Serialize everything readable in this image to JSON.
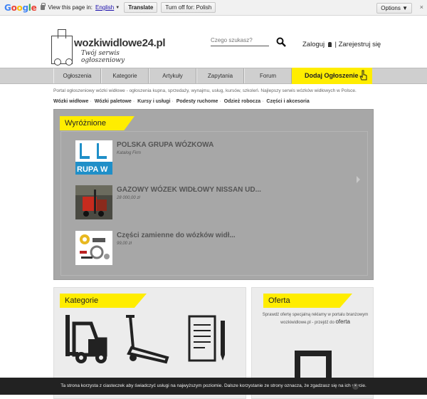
{
  "translate_bar": {
    "brand_letters": [
      "G",
      "o",
      "o",
      "g",
      "l",
      "e"
    ],
    "view_text": "View this page in:",
    "language": "English",
    "caret": "▼",
    "translate_label": "Translate",
    "turn_off_label": "Turn off for: Polish",
    "options_label": "Options ▼",
    "close_glyph": "×"
  },
  "header": {
    "logo_title": "wozkiwidlowe24.pl",
    "logo_tagline": "Twój serwis ogłoszeniowy",
    "search_placeholder": "Czego szukasz?",
    "login_label": "Zaloguj",
    "separator": "|",
    "register_label": "Zarejestruj się"
  },
  "nav": {
    "items": [
      "Ogłoszenia",
      "Kategorie",
      "Artykuły",
      "Zapytania",
      "Forum"
    ],
    "cta_label": "Dodaj Ogłoszenie"
  },
  "intro": "Portal ogłoszeniowy wózki widłowe - ogłoszenia kupna, sprzedaży, wynajmu, usług, kursów, szkoleń. Najlepszy serwis wózków widłowych w Polsce.",
  "categories_line": [
    "Wózki widłowe",
    "Wózki paletowe",
    "Kursy i usługi",
    "Podesty ruchome",
    "Odzież robocza",
    "Części i akcesoria"
  ],
  "featured": {
    "heading": "Wyróżnione",
    "items": [
      {
        "title": "POLSKA GRUPA WÓZKOWA",
        "sub": "Katalog Firm",
        "thumb_text": "RUPA W"
      },
      {
        "title": "GAZOWY WÓZEK WIDŁOWY NISSAN UD...",
        "sub": "28 000,00 zł"
      },
      {
        "title": "Części zamienne do wózków widł...",
        "sub": "99,00 zł"
      }
    ]
  },
  "categories_box": {
    "heading": "Kategorie"
  },
  "offer_box": {
    "heading": "Oferta",
    "text_line1": "Sprawdź ofertę specjalną reklamy w portalu branżowym",
    "text_site": "wozkiwidlowe.pl",
    "text_mid": " - przejdź do ",
    "link_label": "oferta"
  },
  "cookie": {
    "text": "Ta strona korzysta z ciasteczek aby świadczyć usługi na najwyższym poziomie. Dalsze korzystanie ze strony oznacza, że zgadzasz się na ich użycie.",
    "close_glyph": "×"
  },
  "colors": {
    "accent": "#ffed00",
    "nav_bg": "#cfcfcf",
    "featured_bg": "#a7a7a7",
    "cookie_bg": "#222222"
  },
  "icons": [
    "lock-icon",
    "search-icon",
    "user-icon",
    "hand-pointer-icon",
    "forklift-icon",
    "pallet-jack-icon",
    "clipboard-icon",
    "frame-icon",
    "close-icon"
  ]
}
